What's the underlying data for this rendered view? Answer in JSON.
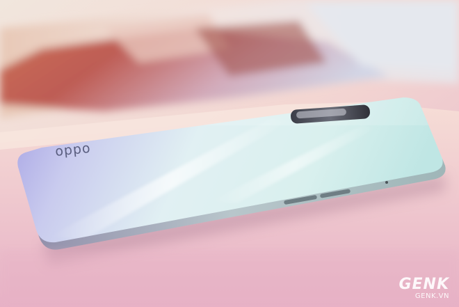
{
  "phone": {
    "brand_text": "oppo"
  },
  "watermark": {
    "logo_text": "GENK",
    "site_text": "GENK.VN"
  }
}
